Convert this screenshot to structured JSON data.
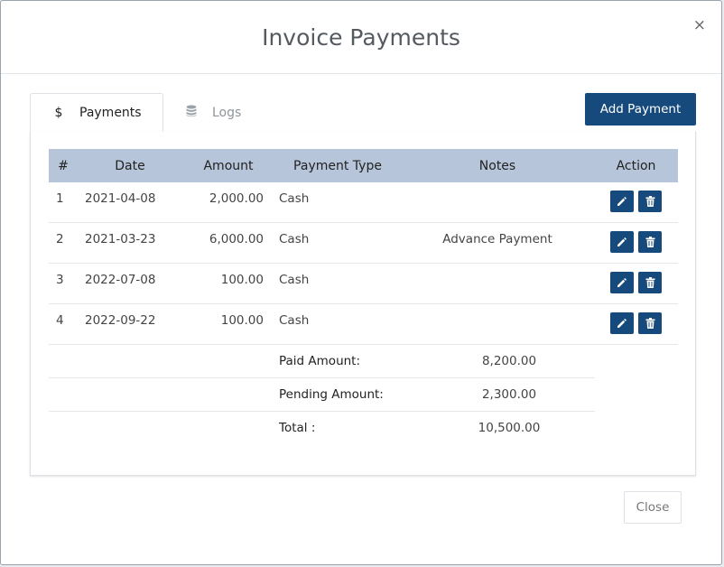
{
  "modal": {
    "title": "Invoice Payments",
    "close_glyph": "×"
  },
  "tabs": [
    {
      "label": "Payments",
      "icon": "dollar-icon",
      "glyph": "$",
      "active": true
    },
    {
      "label": "Logs",
      "icon": "database-icon",
      "active": false
    }
  ],
  "add_button_label": "Add Payment",
  "table": {
    "headers": {
      "num": "#",
      "date": "Date",
      "amount": "Amount",
      "type": "Payment Type",
      "notes": "Notes",
      "action": "Action"
    },
    "rows": [
      {
        "num": "1",
        "date": "2021-04-08",
        "amount": "2,000.00",
        "type": "Cash",
        "notes": ""
      },
      {
        "num": "2",
        "date": "2021-03-23",
        "amount": "6,000.00",
        "type": "Cash",
        "notes": "Advance Payment"
      },
      {
        "num": "3",
        "date": "2022-07-08",
        "amount": "100.00",
        "type": "Cash",
        "notes": ""
      },
      {
        "num": "4",
        "date": "2022-09-22",
        "amount": "100.00",
        "type": "Cash",
        "notes": ""
      }
    ],
    "row_action_icons": [
      "pencil-icon",
      "trash-icon"
    ]
  },
  "summary": {
    "paid_label": "Paid Amount:",
    "paid_value": "8,200.00",
    "pending_label": "Pending Amount:",
    "pending_value": "2,300.00",
    "total_label": "Total :",
    "total_value": "10,500.00"
  },
  "footer": {
    "close_label": "Close"
  },
  "colors": {
    "primary": "#174a7c",
    "header_bg": "#b6c5d9"
  }
}
